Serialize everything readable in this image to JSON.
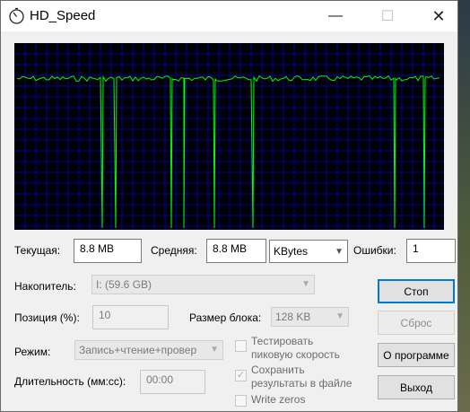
{
  "window": {
    "title": "HD_Speed",
    "minimize": "—",
    "maximize": "☐",
    "close": "✕"
  },
  "graph": {
    "baseline_level": 0.81,
    "spike_positions": [
      0.205,
      0.235,
      0.365,
      0.395,
      0.465,
      0.555,
      0.885,
      0.955
    ]
  },
  "stats": {
    "current_label": "Текущая:",
    "current_value": "8.8 MB",
    "average_label": "Средняя:",
    "average_value": "8.8 MB",
    "units_value": "KBytes",
    "errors_label": "Ошибки:",
    "errors_value": "1"
  },
  "settings": {
    "drive_label": "Накопитель:",
    "drive_value": "I: (59.6 GB)",
    "position_label": "Позиция (%):",
    "position_value": "10",
    "block_label": "Размер блока:",
    "block_value": "128 KB",
    "mode_label": "Режим:",
    "mode_value": "Запись+чтение+провер",
    "duration_label": "Длительность (мм:сс):",
    "duration_value": "00:00"
  },
  "options": {
    "peak_line1": "Тестировать",
    "peak_line2": "пиковую скорость",
    "save_line1": "Сохранить",
    "save_line2": "результаты в файле",
    "zeros_label": "Write zeros"
  },
  "buttons": {
    "stop": "Стоп",
    "reset": "Сброс",
    "about": "О программе",
    "exit": "Выход"
  },
  "colors": {
    "graph_bg": "#000000",
    "grid": "#0000a8",
    "trace": "#00ff00",
    "focus": "#0078d7"
  }
}
